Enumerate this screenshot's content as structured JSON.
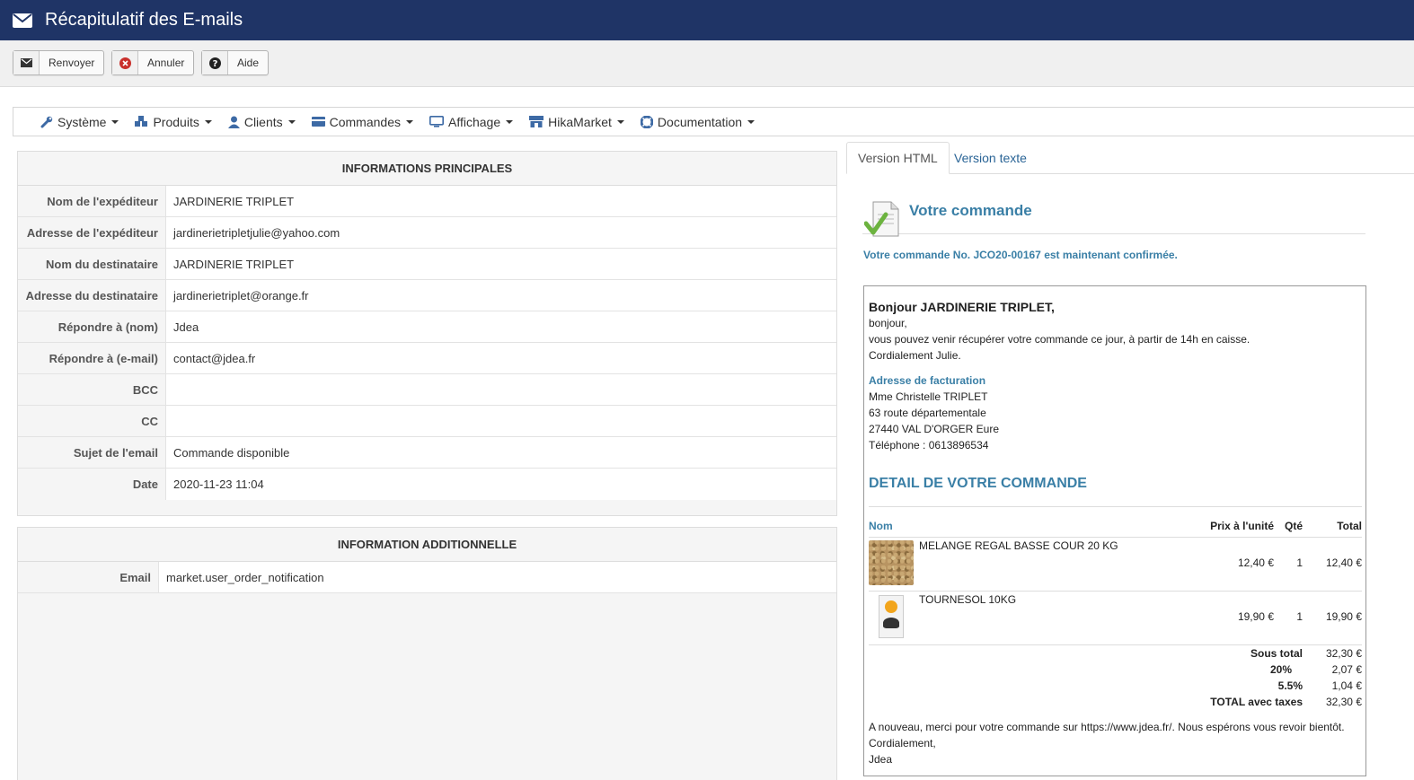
{
  "header": {
    "title": "Récapitulatif des E-mails",
    "icon": "envelope-icon",
    "bg_color": "#1f3466"
  },
  "toolbar": {
    "resend_label": "Renvoyer",
    "cancel_label": "Annuler",
    "help_label": "Aide"
  },
  "nav": {
    "items": [
      {
        "label": "Système",
        "icon": "wrench-icon"
      },
      {
        "label": "Produits",
        "icon": "cubes-icon"
      },
      {
        "label": "Clients",
        "icon": "user-icon"
      },
      {
        "label": "Commandes",
        "icon": "credit-card-icon"
      },
      {
        "label": "Affichage",
        "icon": "monitor-icon"
      },
      {
        "label": "HikaMarket",
        "icon": "store-icon"
      },
      {
        "label": "Documentation",
        "icon": "lifebuoy-icon"
      }
    ]
  },
  "main_info": {
    "title": "INFORMATIONS PRINCIPALES",
    "rows": [
      {
        "key": "Nom de l'expéditeur",
        "value": "JARDINERIE TRIPLET"
      },
      {
        "key": "Adresse de l'expéditeur",
        "value": "jardinerietripletjulie@yahoo.com"
      },
      {
        "key": "Nom du destinataire",
        "value": "JARDINERIE TRIPLET"
      },
      {
        "key": "Adresse du destinataire",
        "value": "jardinerietriplet@orange.fr"
      },
      {
        "key": "Répondre à (nom)",
        "value": "Jdea"
      },
      {
        "key": "Répondre à (e-mail)",
        "value": "contact@jdea.fr"
      },
      {
        "key": "BCC",
        "value": ""
      },
      {
        "key": "CC",
        "value": ""
      },
      {
        "key": "Sujet de l'email",
        "value": "Commande disponible"
      },
      {
        "key": "Date",
        "value": "2020-11-23 11:04"
      }
    ]
  },
  "extra_info": {
    "title": "INFORMATION ADDITIONNELLE",
    "rows": [
      {
        "key": "Email",
        "value": "market.user_order_notification"
      }
    ]
  },
  "tabs": {
    "html": "Version HTML",
    "text": "Version texte"
  },
  "email": {
    "heading": "Votre commande",
    "confirmation": "Votre commande No. JCO20-00167 est maintenant confirmée.",
    "greeting": "Bonjour JARDINERIE TRIPLET,",
    "body_lines": [
      "bonjour,",
      "vous pouvez venir récupérer votre commande ce jour, à partir de 14h en caisse.",
      "Cordialement Julie."
    ],
    "billing_title": "Adresse de facturation",
    "billing_lines": [
      "Mme Christelle TRIPLET",
      "63 route départementale",
      "27440 VAL D'ORGER Eure",
      "Téléphone : 0613896534"
    ],
    "detail_title": "DETAIL DE VOTRE COMMANDE",
    "columns": {
      "name": "Nom",
      "unit_price": "Prix à l'unité",
      "qty": "Qté",
      "total": "Total"
    },
    "items": [
      {
        "name": "MELANGE REGAL BASSE COUR 20 KG",
        "unit_price": "12,40 €",
        "qty": "1",
        "total": "12,40 €"
      },
      {
        "name": "TOURNESOL 10KG",
        "unit_price": "19,90 €",
        "qty": "1",
        "total": "19,90 €"
      }
    ],
    "totals": [
      {
        "label": "Sous total",
        "value": "32,30 €"
      },
      {
        "label": "20%",
        "value": "2,07 €"
      },
      {
        "label": "5.5%",
        "value": "1,04 €"
      },
      {
        "label": "TOTAL avec taxes",
        "value": "32,30 €"
      }
    ],
    "footer_lines": [
      "A nouveau, merci pour votre commande sur https://www.jdea.fr/. Nous espérons vous revoir bientôt.",
      "Cordialement,",
      "Jdea"
    ],
    "accent_color": "#3a7fa6"
  }
}
